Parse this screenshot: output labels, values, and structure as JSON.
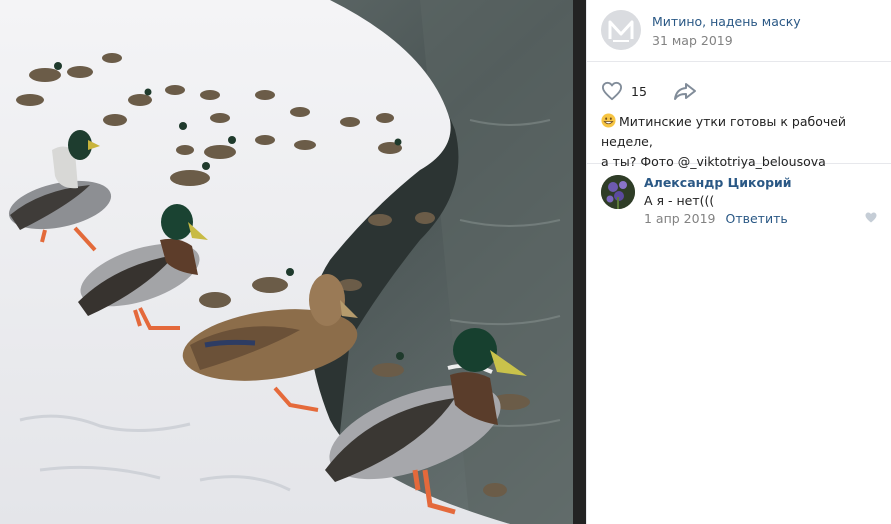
{
  "photo": {
    "description_icon": "ducks-photo"
  },
  "post": {
    "group_name": "Митино, надень маску",
    "date": "31 мар 2019",
    "likes": "15",
    "caption_line1": "Митинские утки готовы к рабочей неделе,",
    "caption_line2": "а ты? Фото @_viktotriya_belousova",
    "emoji": "grinning-face-icon"
  },
  "comment": {
    "author": "Александр Цикорий",
    "text": "А я - нет(((",
    "date": "1 апр 2019",
    "reply": "Ответить"
  },
  "colors": {
    "link": "#2a5885",
    "muted": "#828282",
    "text": "#222222",
    "divider": "#232323"
  }
}
